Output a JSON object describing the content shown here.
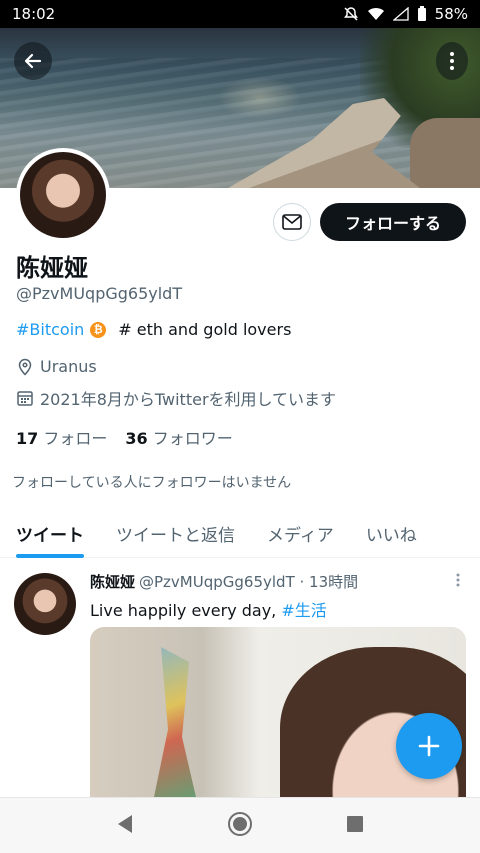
{
  "status_bar": {
    "time": "18:02",
    "battery": "58%"
  },
  "profile": {
    "follow_label": "フォローする",
    "name": "陈娅娅",
    "handle": "@PzvMUqpGg65yldT",
    "bio": {
      "hashtag": "#Bitcoin",
      "btc_symbol": "₿",
      "text": "# eth and gold lovers"
    },
    "location": "Uranus",
    "joined": "2021年8月からTwitterを利用しています",
    "following_count": "17",
    "following_label": "フォロー",
    "followers_count": "36",
    "followers_label": "フォロワー",
    "notice": "フォローしている人にフォロワーはいません"
  },
  "tabs": [
    {
      "label": "ツイート",
      "active": true
    },
    {
      "label": "ツイートと返信",
      "active": false
    },
    {
      "label": "メディア",
      "active": false
    },
    {
      "label": "いいね",
      "active": false
    }
  ],
  "tweet": {
    "name": "陈娅娅",
    "handle_time": "@PzvMUqpGg65yldT · 13時間",
    "text": "Live happily every day,",
    "hashtag": "#生活"
  },
  "colors": {
    "accent": "#1d9bf0",
    "text": "#0f1419",
    "secondary": "#536471",
    "btc": "#f7931a"
  },
  "icons": [
    "back-arrow-icon",
    "more-vertical-icon",
    "mail-icon",
    "location-pin-icon",
    "calendar-icon",
    "plus-icon",
    "nav-back-icon",
    "nav-home-icon",
    "nav-recents-icon"
  ]
}
